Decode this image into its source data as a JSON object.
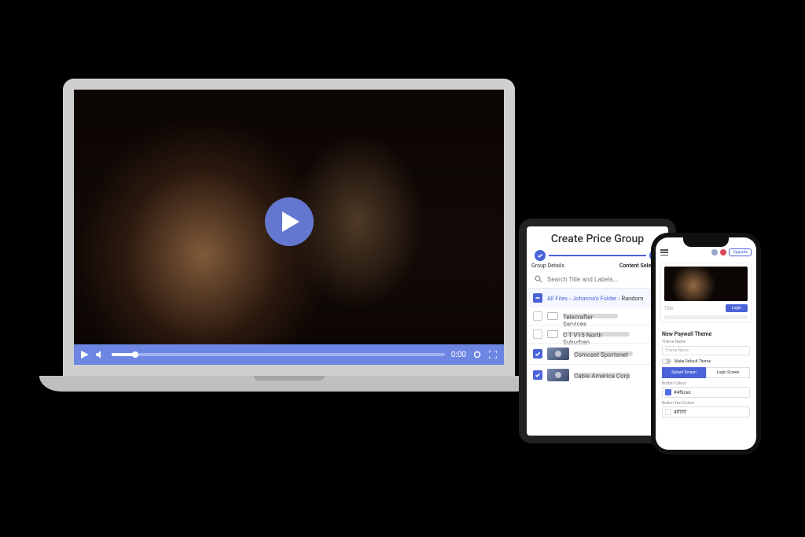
{
  "brand_blue": "#4a63d8",
  "video": {
    "time_elapsed": "0:00",
    "progress_pct": 7
  },
  "tablet": {
    "title": "Create Price Group",
    "steps": {
      "one": "Group Details",
      "two": "Content Selection"
    },
    "search_placeholder": "Search Title and Labels...",
    "breadcrumb": {
      "root": "All Files",
      "folder": "Johanna's Folder",
      "current": "Random"
    },
    "items": [
      {
        "kind": "folder",
        "label": "Telecrafter Services",
        "checked": false
      },
      {
        "kind": "folder",
        "label": "C T V15 North Suburban",
        "checked": false
      },
      {
        "kind": "video",
        "label": "Comcast Sportsnet",
        "checked": true
      },
      {
        "kind": "video",
        "label": "Cable America Corp",
        "checked": true
      }
    ]
  },
  "phone": {
    "upgrade": "Upgrade",
    "preview_title_label": "Title",
    "login_label": "Login",
    "section_title": "New Paywall Theme",
    "theme_name_label": "Theme Name",
    "theme_name_placeholder": "Theme Name",
    "default_toggle_label": "Make Default Theme",
    "tabs": {
      "splash": "Splash Screen",
      "login": "Login Screen"
    },
    "button_colour_label": "Button Colour",
    "button_colour_value": "#4f6cec",
    "button_text_colour_label": "Button Text Colour",
    "button_text_colour_value": "#ffffff"
  }
}
